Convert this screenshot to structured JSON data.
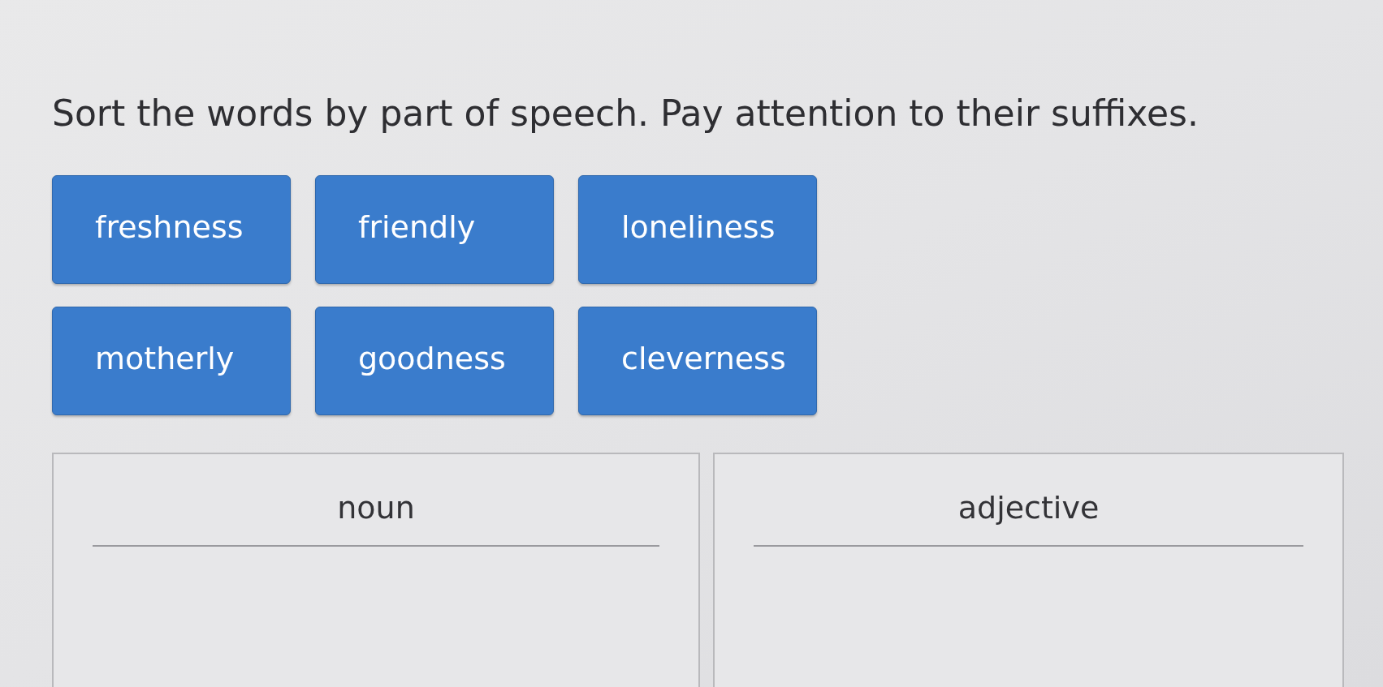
{
  "instruction": "Sort the words by part of speech. Pay attention to their suffixes.",
  "word_tiles": [
    "freshness",
    "friendly",
    "loneliness",
    "motherly",
    "goodness",
    "cleverness"
  ],
  "drop_zones": [
    {
      "label": "noun"
    },
    {
      "label": "adjective"
    }
  ]
}
